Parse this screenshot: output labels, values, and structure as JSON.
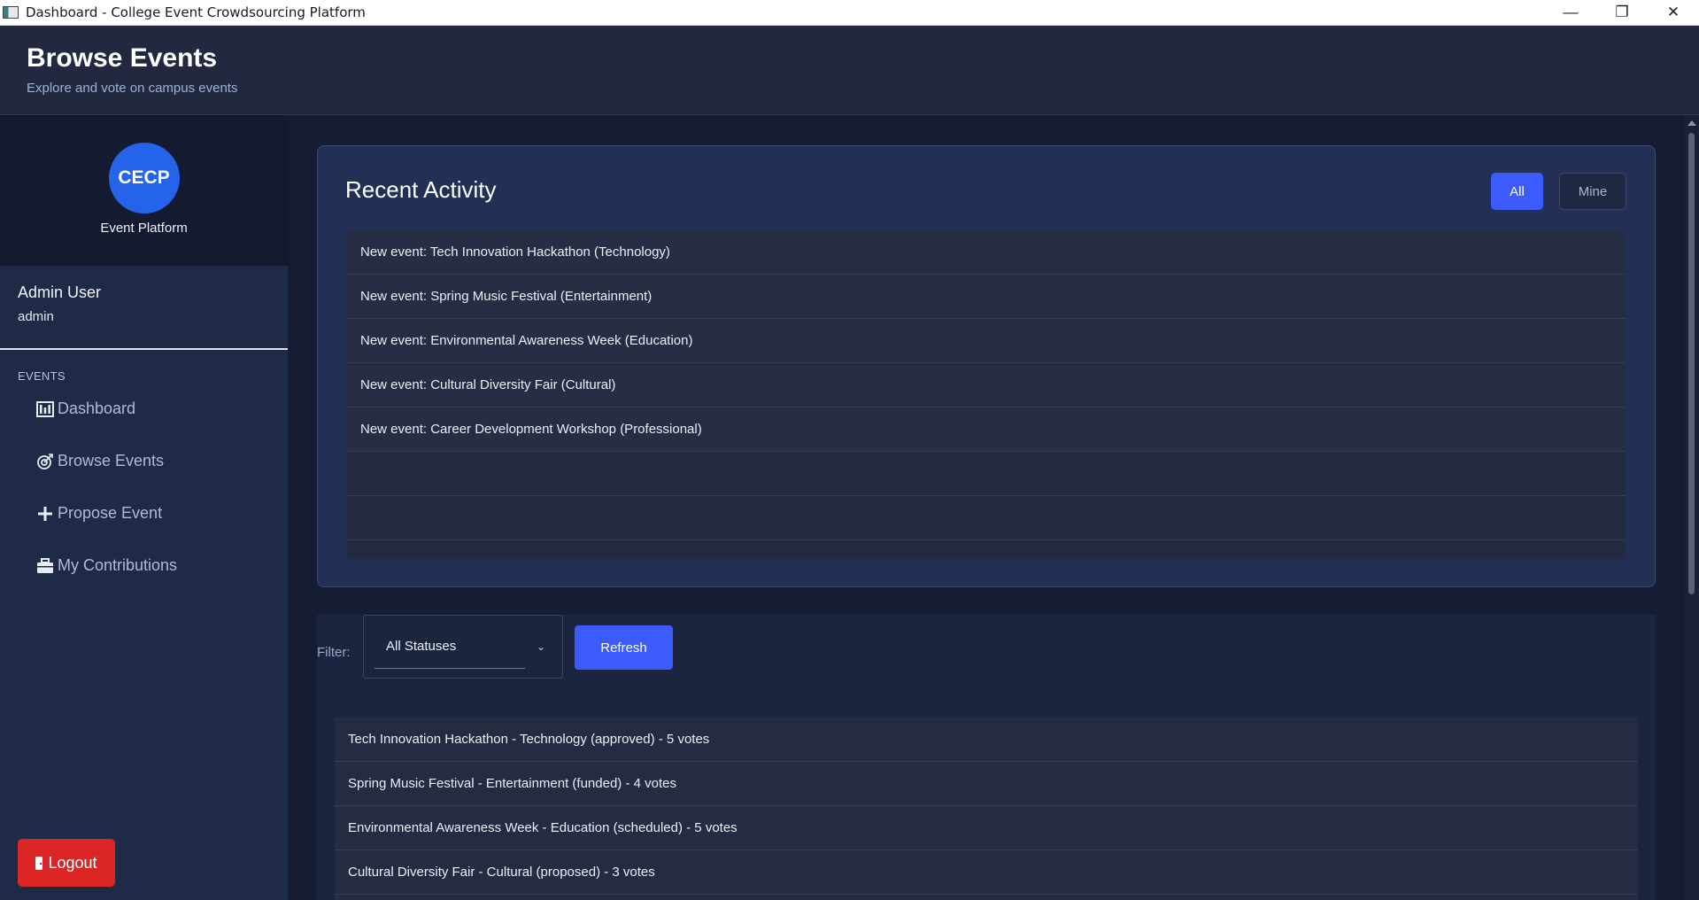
{
  "window": {
    "title": "Dashboard - College Event Crowdsourcing Platform",
    "controls": {
      "minimize": "—",
      "restore": "❐",
      "close": "✕"
    }
  },
  "header": {
    "title": "Browse Events",
    "subtitle": "Explore and vote on campus events"
  },
  "brand": {
    "logo_text": "CECP",
    "name": "Event Platform",
    "logo_color": "#2563eb"
  },
  "user": {
    "name": "Admin User",
    "role": "admin"
  },
  "nav": {
    "section_heading": "EVENTS",
    "items": [
      {
        "label": "Dashboard",
        "icon": "bar-chart-icon"
      },
      {
        "label": "Browse Events",
        "icon": "target-icon"
      },
      {
        "label": "Propose Event",
        "icon": "plus-icon"
      },
      {
        "label": "My Contributions",
        "icon": "briefcase-icon"
      }
    ],
    "logout_label": "Logout"
  },
  "activity": {
    "title": "Recent Activity",
    "filter_all": "All",
    "filter_mine": "Mine",
    "items": [
      "New event: Tech Innovation Hackathon (Technology)",
      "New event: Spring Music Festival (Entertainment)",
      "New event: Environmental Awareness Week (Education)",
      "New event: Cultural Diversity Fair (Cultural)",
      "New event: Career Development Workshop (Professional)"
    ]
  },
  "filter": {
    "label": "Filter:",
    "selected": "All Statuses",
    "refresh_label": "Refresh"
  },
  "events": [
    "Tech Innovation Hackathon - Technology (approved) - 5 votes",
    "Spring Music Festival - Entertainment (funded) - 4 votes",
    "Environmental Awareness Week - Education (scheduled) - 5 votes",
    "Cultural Diversity Fair - Cultural (proposed) - 3 votes"
  ],
  "colors": {
    "accent": "#3b5bfd",
    "danger": "#dc2626",
    "sidebar": "#1f2a47",
    "header": "#212840"
  }
}
